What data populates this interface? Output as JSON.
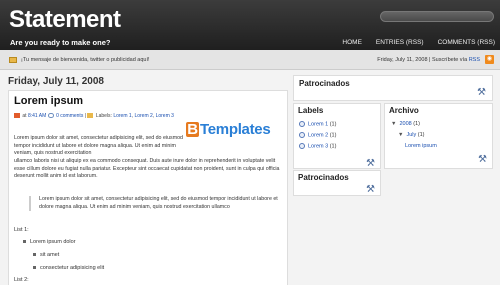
{
  "header": {
    "title": "Statement",
    "description": "Are you ready to make one?",
    "nav": [
      "HOME",
      "ENTRIES (RSS)",
      "COMMENTS (RSS)"
    ]
  },
  "infobar": {
    "message": "¡Tu mensaje de bienvenida, twitter o publicidad aquí!",
    "date_text": "Friday, July 11, 2008 | Suscríbete vía",
    "rss_label": "RSS"
  },
  "post": {
    "date": "Friday, July 11, 2008",
    "title": "Lorem ipsum",
    "meta": {
      "at": "at",
      "time": "8:41 AM",
      "comments": "0 comments",
      "labels_prefix": "Labels:",
      "labels": [
        "Lorem 1",
        "Lorem 2",
        "Lorem 3"
      ]
    },
    "logo_letter": "B",
    "logo_text": "Templates",
    "paragraph1": "Lorem ipsum dolor sit amet, consectetur adipisicing elit, sed do eiusmod tempor incididunt ut labore et dolore magna aliqua. Ut enim ad minim veniam, quis nostrud exercitation",
    "paragraph2": "ullamco laboris nisi ut aliquip ex ea commodo consequat. Duis aute irure dolor in reprehenderit in voluptate velit esse cillum dolore eu fugiat nulla pariatur. Excepteur sint occaecat cupidatat non proident, sunt in culpa qui officia deserunt mollit anim id est laborum.",
    "blockquote": "Lorem ipsum dolor sit amet, consectetur adipisicing elit, sed do eiusmod tempor incididunt ut labore et dolore magna aliqua. Ut enim ad minim veniam, quis nostrud exercitation ullamco",
    "list1_label": "List 1:",
    "list_items": [
      "Lorem ipsum dolor",
      "sit amet",
      "consectetur adipisicing elit"
    ],
    "list2_label": "List 2:"
  },
  "sidebar": {
    "patrocinados_1": "Patrocinados",
    "labels_title": "Labels",
    "labels": [
      {
        "name": "Lorem 1",
        "count": "(1)"
      },
      {
        "name": "Lorem 2",
        "count": "(1)"
      },
      {
        "name": "Lorem 3",
        "count": "(1)"
      }
    ],
    "patrocinados_2": "Patrocinados",
    "archive_title": "Archivo",
    "archive": {
      "year": "2008",
      "year_count": "(1)",
      "month": "July",
      "month_count": "(1)",
      "post": "Lorem ipsum"
    }
  },
  "icons": {
    "tool": "wrench-screwdriver-icon",
    "rss": "rss-feed-icon",
    "info": "envelope-icon"
  }
}
